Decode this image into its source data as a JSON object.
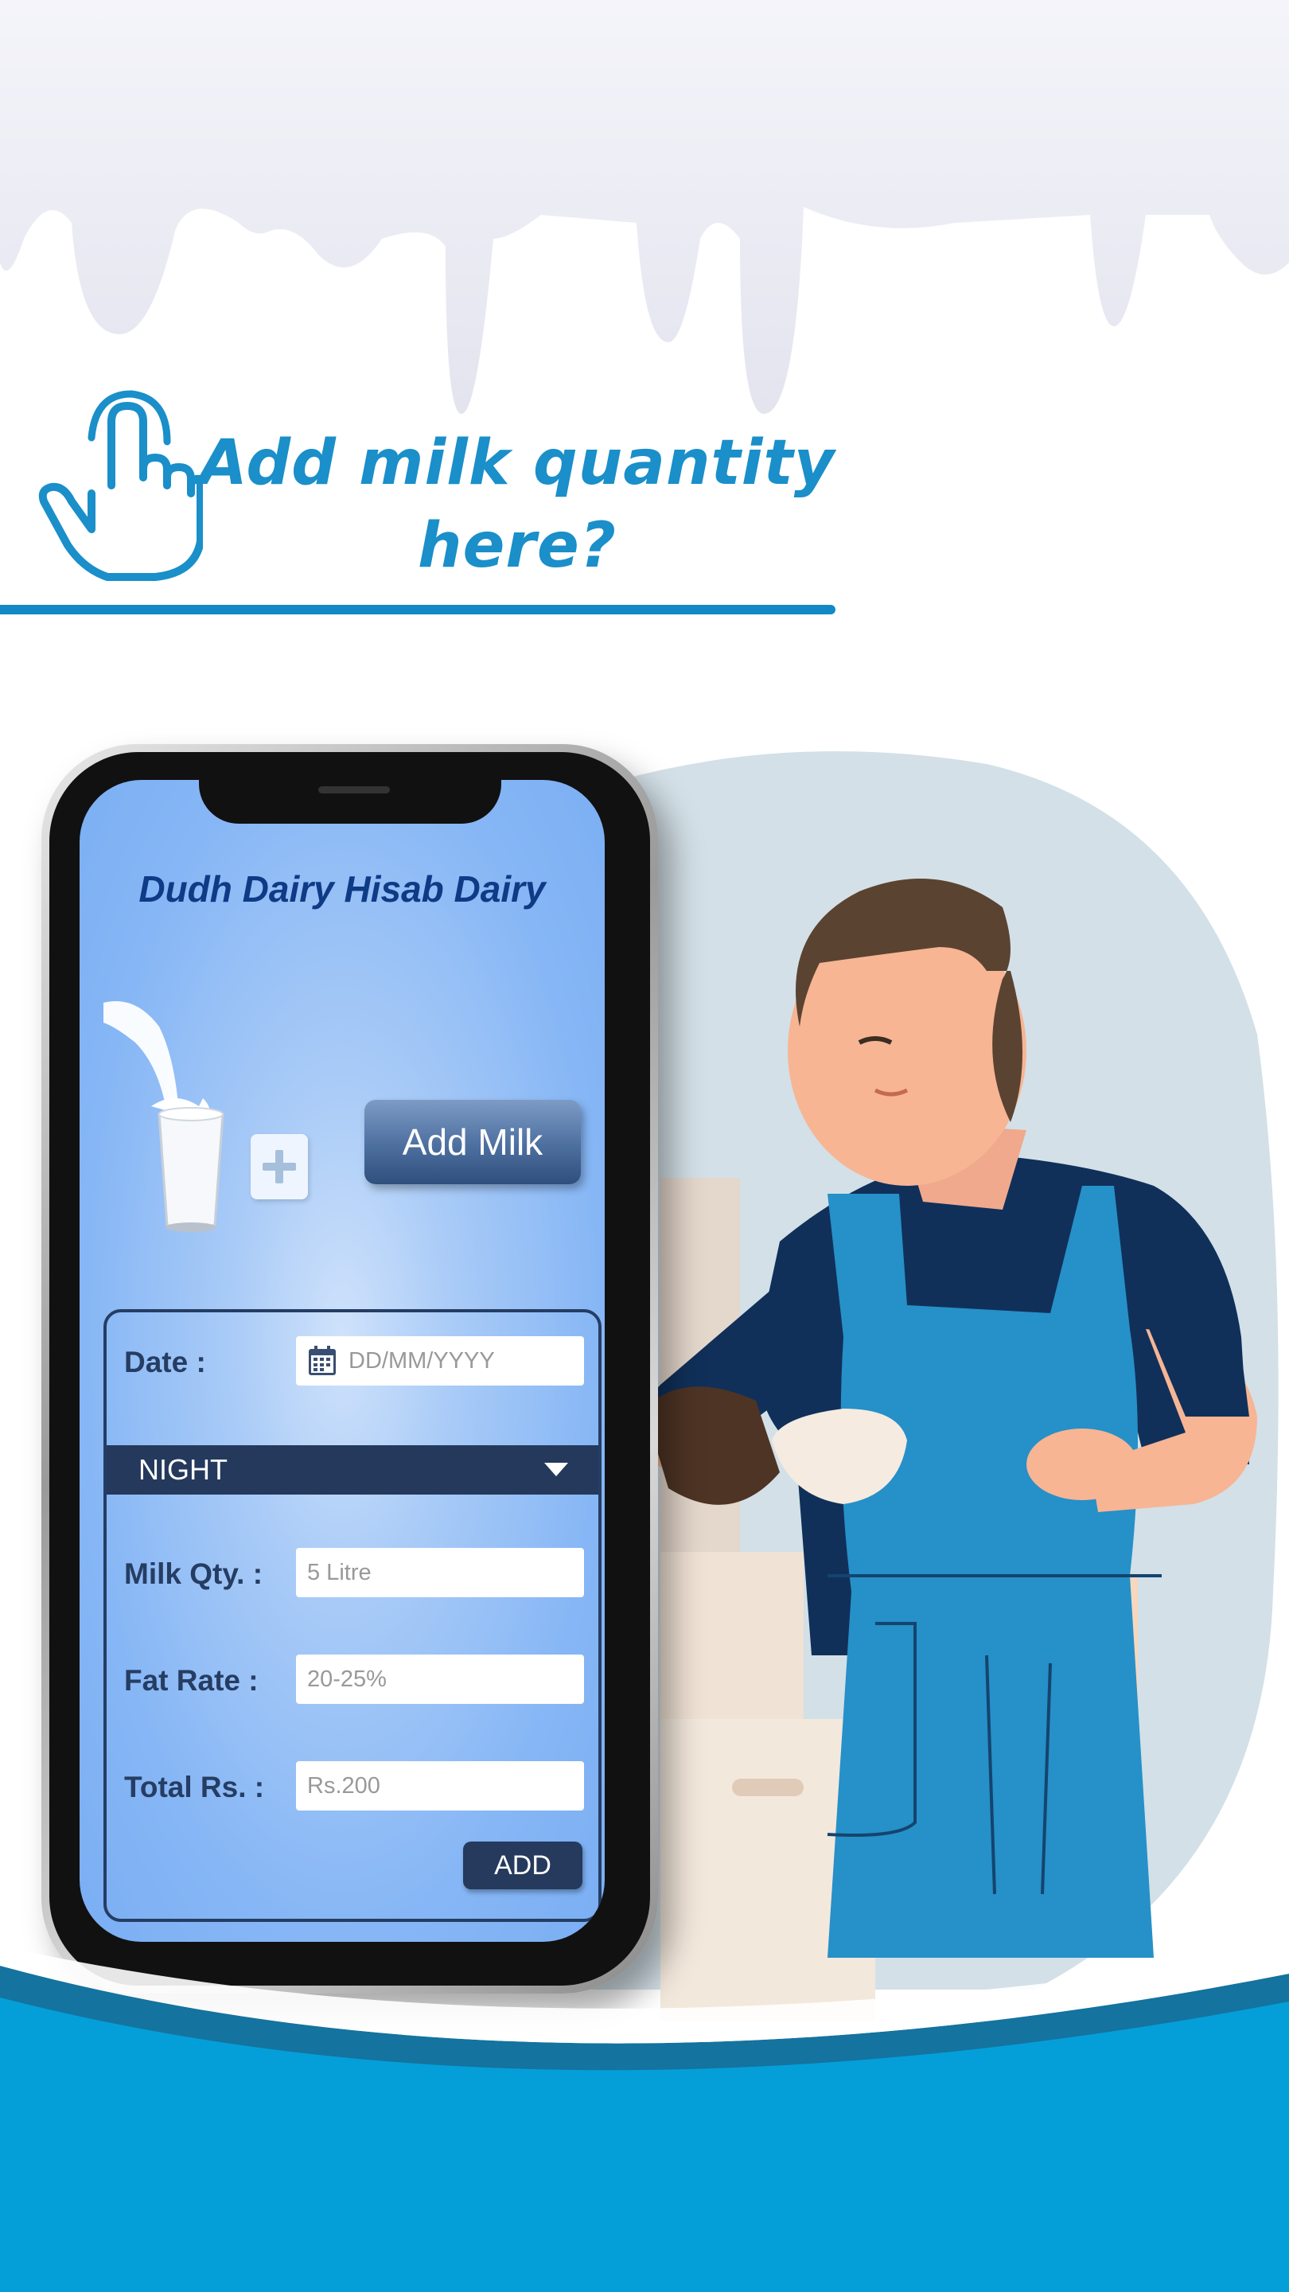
{
  "headline": {
    "line1": "Add milk quantity",
    "line2": "here?"
  },
  "app": {
    "title": "Dudh Dairy Hisab Dairy",
    "add_milk_label": "Add Milk",
    "form": {
      "date_label": "Date :",
      "date_placeholder": "DD/MM/YYYY",
      "shift_value": "NIGHT",
      "milk_qty_label": "Milk Qty. :",
      "milk_qty_placeholder": "5 Litre",
      "fat_rate_label": "Fat Rate :",
      "fat_rate_placeholder": "20-25%",
      "total_label": "Total Rs. :",
      "total_placeholder": "Rs.200",
      "add_label": "ADD"
    }
  },
  "icons": [
    "hand-pointer-icon",
    "plus-icon",
    "calendar-icon",
    "chevron-down-icon"
  ],
  "colors": {
    "accent": "#1a8fc9",
    "dark_navy": "#24395c",
    "wave_blue": "#049fd9"
  }
}
